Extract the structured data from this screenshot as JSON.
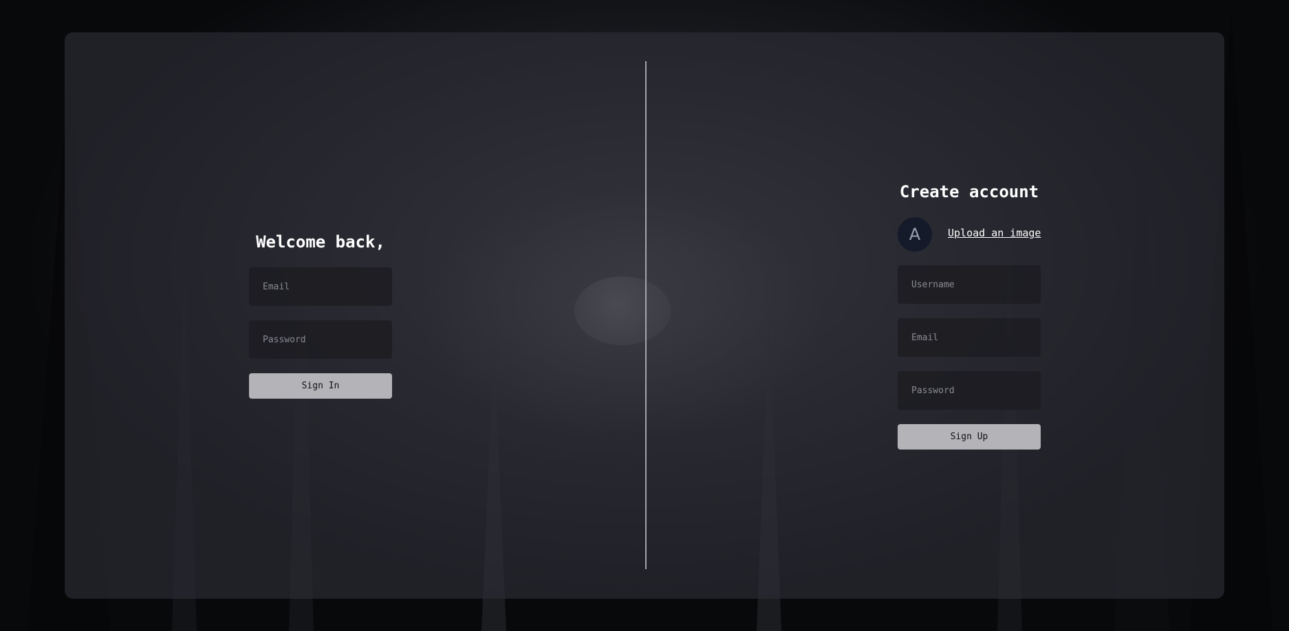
{
  "sign_in": {
    "title": "Welcome back,",
    "email_placeholder": "Email",
    "password_placeholder": "Password",
    "button_label": "Sign In"
  },
  "sign_up": {
    "title": "Create account",
    "avatar_initial": "A",
    "upload_label": "Upload an image",
    "username_placeholder": "Username",
    "email_placeholder": "Email",
    "password_placeholder": "Password",
    "button_label": "Sign Up"
  },
  "colors": {
    "card_background": "#2e2e38",
    "button_background": "#b4b4b8",
    "input_background": "#1c1c21",
    "avatar_background": "#141a29",
    "divider": "#b9b9bf"
  }
}
